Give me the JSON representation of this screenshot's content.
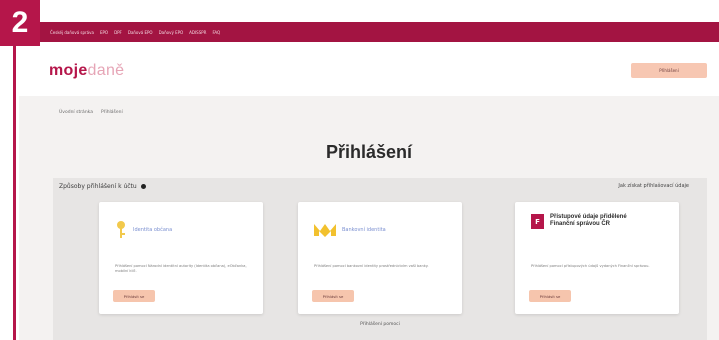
{
  "step_number": "2",
  "topbar": {
    "links": [
      "Českéj daňová správa",
      "EPO",
      "DPF",
      "Daňová EPO",
      "Daňový EPO",
      "ADISSPR",
      "FAQ"
    ]
  },
  "header": {
    "logo_part1": "moje",
    "logo_part2": "daně",
    "login_button": "Přihlášení"
  },
  "breadcrumb": [
    "Úvodní stránka",
    "Přihlášení"
  ],
  "page_title": "Přihlášení",
  "methods": {
    "heading": "Způsoby přihlášení k účtu",
    "right_link": "Jak získat přihlašovací údaje",
    "more_link": "Přihlášení pomoci"
  },
  "cards": [
    {
      "logo_text": "Identita občana",
      "description": "Přihlášení pomocí Národní identitní autority (Identita občana), eObčanka, mobilní klíč.",
      "button": "Přihlásit se"
    },
    {
      "logo_text": "Bankovní identita",
      "description": "Přihlášení pomocí bankovní identity prostřednictvím vaší banky.",
      "button": "Přihlásit se"
    },
    {
      "title": "Přístupové údaje přidělené Finanční správou ČR",
      "description": "Přihlášení pomocí přístupových údajů vydaných Finanční správou.",
      "button": "Přihlásit se"
    }
  ],
  "colors": {
    "brand": "#b5164a",
    "button_bg": "#f6c5ad"
  }
}
